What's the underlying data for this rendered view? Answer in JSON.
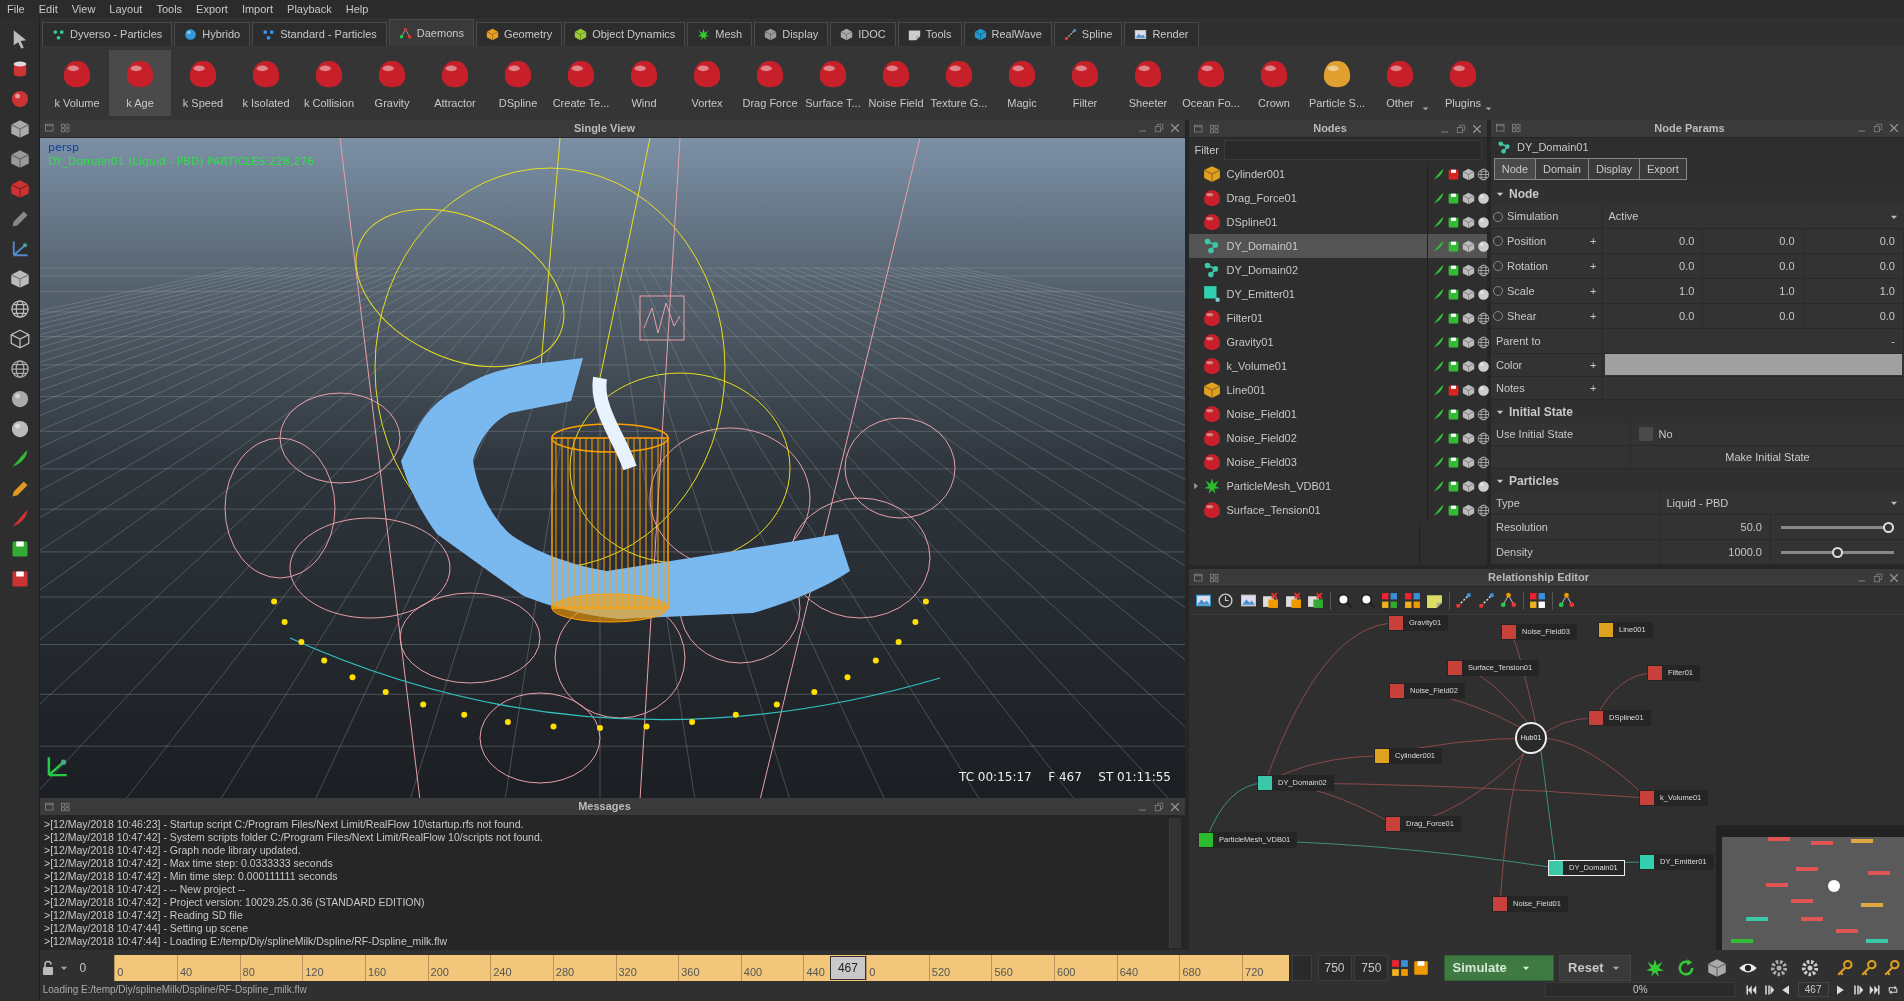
{
  "menu": [
    "File",
    "Edit",
    "View",
    "Layout",
    "Tools",
    "Export",
    "Import",
    "Playback",
    "Help"
  ],
  "tabs": [
    {
      "label": "Dyverso - Particles",
      "selected": false
    },
    {
      "label": "Hybrido",
      "selected": false
    },
    {
      "label": "Standard - Particles",
      "selected": false
    },
    {
      "label": "Daemons",
      "selected": true
    },
    {
      "label": "Geometry",
      "selected": false
    },
    {
      "label": "Object Dynamics",
      "selected": false
    },
    {
      "label": "Mesh",
      "selected": false
    },
    {
      "label": "Display",
      "selected": false
    },
    {
      "label": "IDOC",
      "selected": false
    },
    {
      "label": "Tools",
      "selected": false
    },
    {
      "label": "RealWave",
      "selected": false
    },
    {
      "label": "Spline",
      "selected": false
    },
    {
      "label": "Render",
      "selected": false
    }
  ],
  "toolbar": [
    {
      "label": "k Volume",
      "selected": false,
      "dropdown": false
    },
    {
      "label": "k Age",
      "selected": true,
      "dropdown": false
    },
    {
      "label": "k Speed",
      "selected": false,
      "dropdown": false
    },
    {
      "label": "k Isolated",
      "selected": false,
      "dropdown": false
    },
    {
      "label": "k Collision",
      "selected": false,
      "dropdown": false
    },
    {
      "label": "Gravity",
      "selected": false,
      "dropdown": false
    },
    {
      "label": "Attractor",
      "selected": false,
      "dropdown": false
    },
    {
      "label": "DSpline",
      "selected": false,
      "dropdown": false
    },
    {
      "label": "Create Te...",
      "selected": false,
      "dropdown": false
    },
    {
      "label": "Wind",
      "selected": false,
      "dropdown": false
    },
    {
      "label": "Vortex",
      "selected": false,
      "dropdown": false
    },
    {
      "label": "Drag Force",
      "selected": false,
      "dropdown": false
    },
    {
      "label": "Surface T...",
      "selected": false,
      "dropdown": false
    },
    {
      "label": "Noise Field",
      "selected": false,
      "dropdown": false
    },
    {
      "label": "Texture G...",
      "selected": false,
      "dropdown": false
    },
    {
      "label": "Magic",
      "selected": false,
      "dropdown": false
    },
    {
      "label": "Filter",
      "selected": false,
      "dropdown": false
    },
    {
      "label": "Sheeter",
      "selected": false,
      "dropdown": false
    },
    {
      "label": "Ocean Fo...",
      "selected": false,
      "dropdown": false
    },
    {
      "label": "Crown",
      "selected": false,
      "dropdown": false
    },
    {
      "label": "Particle S...",
      "selected": false,
      "dropdown": false
    },
    {
      "label": "Other",
      "selected": false,
      "dropdown": true
    },
    {
      "label": "Plugins",
      "selected": false,
      "dropdown": true
    }
  ],
  "viewport": {
    "title": "Single View",
    "camera": "persp",
    "info": "DY_Domain01 (Liquid - PBD) PARTICLES:228,276",
    "timecode": "TC 00:15:17",
    "frame": "F 467",
    "sim_time": "ST 01:11:55"
  },
  "messages": {
    "title": "Messages",
    "lines": [
      ">[12/May/2018 10:46:23] - Startup script C:/Program Files/Next Limit/RealFlow 10\\startup.rfs not found.",
      ">[12/May/2018 10:47:42] - System scripts folder C:/Program Files/Next Limit/RealFlow 10/scripts not found.",
      ">[12/May/2018 10:47:42] - Graph node library updated.",
      ">[12/May/2018 10:47:42] - Max time step: 0.0333333 seconds",
      ">[12/May/2018 10:47:42] - Min time step: 0.000111111 seconds",
      ">[12/May/2018 10:47:42] - -- New project --",
      ">[12/May/2018 10:47:42] - Project version: 10029.25.0.36 (STANDARD EDITION)",
      ">[12/May/2018 10:47:42] - Reading SD file",
      ">[12/May/2018 10:47:44] - Setting up scene",
      ">[12/May/2018 10:47:44] -  Loading E:/temp/Diy/splineMilk/Dspline/RF-Dspline_milk.flw"
    ]
  },
  "nodes": {
    "title": "Nodes",
    "filter_label": "Filter",
    "items": [
      {
        "name": "Cylinder001",
        "kind": "object",
        "selected": false,
        "export": false,
        "wireframe": true,
        "expander": false
      },
      {
        "name": "Drag_Force01",
        "kind": "daemon",
        "selected": false,
        "export": true,
        "wireframe": false,
        "expander": false
      },
      {
        "name": "DSpline01",
        "kind": "daemon",
        "selected": false,
        "export": true,
        "wireframe": false,
        "expander": false
      },
      {
        "name": "DY_Domain01",
        "kind": "domain",
        "selected": true,
        "export": true,
        "wireframe": false,
        "expander": false
      },
      {
        "name": "DY_Domain02",
        "kind": "domain",
        "selected": false,
        "export": true,
        "wireframe": true,
        "expander": false
      },
      {
        "name": "DY_Emitter01",
        "kind": "emitter",
        "selected": false,
        "export": true,
        "wireframe": false,
        "expander": false
      },
      {
        "name": "Filter01",
        "kind": "daemon",
        "selected": false,
        "export": true,
        "wireframe": true,
        "expander": false
      },
      {
        "name": "Gravity01",
        "kind": "daemon",
        "selected": false,
        "export": true,
        "wireframe": true,
        "expander": false
      },
      {
        "name": "k_Volume01",
        "kind": "daemon",
        "selected": false,
        "export": true,
        "wireframe": false,
        "expander": false
      },
      {
        "name": "Line001",
        "kind": "object",
        "selected": false,
        "export": false,
        "wireframe": false,
        "expander": false
      },
      {
        "name": "Noise_Field01",
        "kind": "daemon",
        "selected": false,
        "export": true,
        "wireframe": true,
        "expander": false
      },
      {
        "name": "Noise_Field02",
        "kind": "daemon",
        "selected": false,
        "export": true,
        "wireframe": true,
        "expander": false
      },
      {
        "name": "Noise_Field03",
        "kind": "daemon",
        "selected": false,
        "export": true,
        "wireframe": true,
        "expander": false
      },
      {
        "name": "ParticleMesh_VDB01",
        "kind": "mesh",
        "selected": false,
        "export": true,
        "wireframe": false,
        "expander": true
      },
      {
        "name": "Surface_Tension01",
        "kind": "daemon",
        "selected": false,
        "export": true,
        "wireframe": true,
        "expander": false
      }
    ]
  },
  "params": {
    "title": "Node Params",
    "node": "DY_Domain01",
    "tabs": [
      {
        "label": "Node",
        "selected": true
      },
      {
        "label": "Domain",
        "selected": false
      },
      {
        "label": "Display",
        "selected": false
      },
      {
        "label": "Export",
        "selected": false
      }
    ],
    "sections": [
      {
        "title": "Node",
        "expanded": true,
        "rows": [
          {
            "kind": "dropdown",
            "label": "Simulation",
            "value": "Active",
            "keyed": false
          },
          {
            "kind": "vector",
            "label": "Position",
            "plus": "+",
            "values": [
              "0.0",
              "0.0",
              "0.0"
            ],
            "keyed": false
          },
          {
            "kind": "vector",
            "label": "Rotation",
            "plus": "+",
            "values": [
              "0.0",
              "0.0",
              "0.0"
            ],
            "keyed": false
          },
          {
            "kind": "vector",
            "label": "Scale",
            "plus": "+",
            "values": [
              "1.0",
              "1.0",
              "1.0"
            ],
            "keyed": false
          },
          {
            "kind": "vector",
            "label": "Shear",
            "plus": "+",
            "values": [
              "0.0",
              "0.0",
              "0.0"
            ],
            "keyed": false
          },
          {
            "kind": "text",
            "label": "Parent to",
            "value": "-"
          },
          {
            "kind": "color",
            "label": "Color",
            "plus": "+",
            "color": "#a0a0a0"
          },
          {
            "kind": "notes",
            "label": "Notes",
            "plus": "+"
          }
        ]
      },
      {
        "title": "Initial State",
        "expanded": true,
        "rows": [
          {
            "kind": "checkbox",
            "label": "Use Initial State",
            "checked": false,
            "value": "No"
          },
          {
            "kind": "button",
            "label": "Make Initial State"
          }
        ]
      },
      {
        "title": "Particles",
        "expanded": true,
        "rows": [
          {
            "kind": "dropdown",
            "label": "Type",
            "value": "Liquid - PBD"
          },
          {
            "kind": "slider",
            "label": "Resolution",
            "value": "50.0",
            "level": 1.0
          },
          {
            "kind": "slider",
            "label": "Density",
            "value": "1000.0",
            "level": 0.5
          }
        ]
      }
    ]
  },
  "relationship": {
    "title": "Relationship Editor",
    "nodes": [
      {
        "label": "Gravity01",
        "kind": "daemon",
        "selected": false
      },
      {
        "label": "Noise_Field03",
        "kind": "daemon",
        "selected": false
      },
      {
        "label": "Line001",
        "kind": "object",
        "selected": false
      },
      {
        "label": "Surface_Tension01",
        "kind": "daemon",
        "selected": false
      },
      {
        "label": "Filter01",
        "kind": "daemon",
        "selected": false
      },
      {
        "label": "Noise_Field02",
        "kind": "daemon",
        "selected": false
      },
      {
        "label": "DSpline01",
        "kind": "daemon",
        "selected": false
      },
      {
        "label": "Hub01",
        "kind": "hub",
        "selected": false
      },
      {
        "label": "Cylinder001",
        "kind": "object",
        "selected": false
      },
      {
        "label": "DY_Domain02",
        "kind": "domain",
        "selected": false
      },
      {
        "label": "k_Volume01",
        "kind": "daemon",
        "selected": false
      },
      {
        "label": "Drag_Force01",
        "kind": "daemon",
        "selected": false
      },
      {
        "label": "ParticleMesh_VDB01",
        "kind": "mesh",
        "selected": false
      },
      {
        "label": "DY_Emitter01",
        "kind": "emitter",
        "selected": false
      },
      {
        "label": "DY_Domain01",
        "kind": "domain",
        "selected": true
      },
      {
        "label": "Noise_Field01",
        "kind": "daemon",
        "selected": false
      }
    ]
  },
  "timeline": {
    "start": "0",
    "ticks": [
      "0",
      "40",
      "80",
      "120",
      "160",
      "200",
      "240",
      "280",
      "320",
      "360",
      "400",
      "440",
      "0",
      "520",
      "560",
      "600",
      "640",
      "680",
      "720"
    ],
    "current": "467",
    "level": 0.6227,
    "end_a": "750",
    "end_b": "750"
  },
  "simulation": {
    "simulate": "Simulate",
    "reset": "Reset",
    "progress": "0%",
    "frame_field": "467"
  },
  "status_bar": "Loading E:/temp/Diy/splineMilk/Dspline/RF-Dspline_milk.flw"
}
